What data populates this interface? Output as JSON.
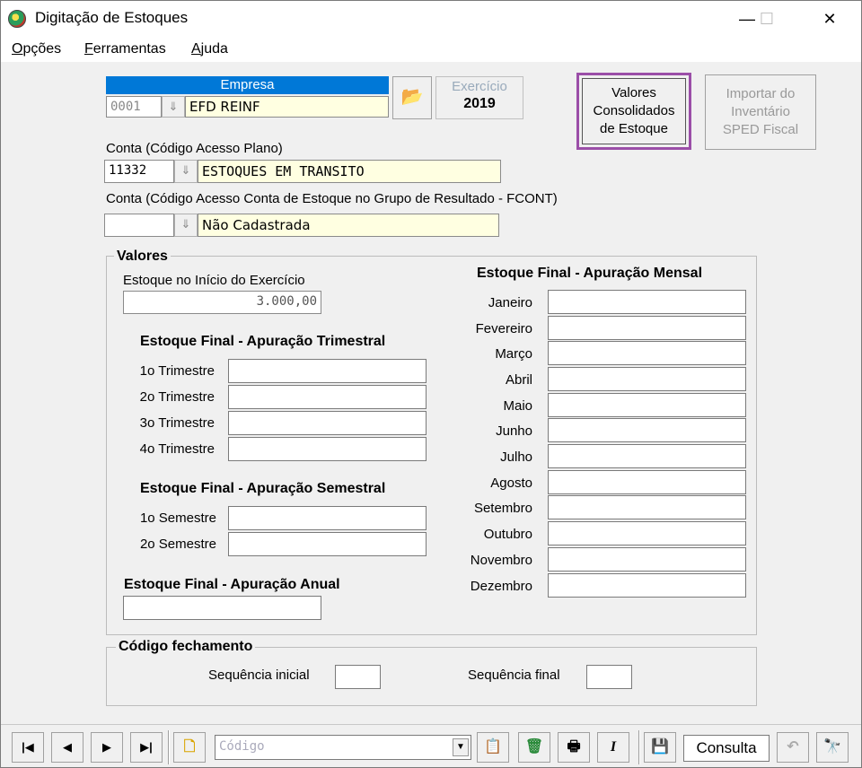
{
  "window": {
    "title": "Digitação de Estoques",
    "minimize": "—",
    "maximize": "☐",
    "close": "✕"
  },
  "menu": [
    {
      "prefix": "",
      "underline": "O",
      "rest": "pções"
    },
    {
      "prefix": "",
      "underline": "F",
      "rest": "erramentas"
    },
    {
      "prefix": "",
      "underline": "A",
      "rest": "juda"
    }
  ],
  "empresa": {
    "header": "Empresa",
    "code": "0001",
    "name": "EFD REINF",
    "exercicio_label": "Exercício",
    "exercicio_value": "2019"
  },
  "buttons": {
    "valores_consolidados": [
      "Valores",
      "Consolidados",
      "de Estoque"
    ],
    "importar": [
      "Importar do",
      "Inventário",
      "SPED Fiscal"
    ]
  },
  "conta": {
    "label": "Conta (Código Acesso Plano)",
    "code": "11332",
    "name": "ESTOQUES EM TRANSITO"
  },
  "conta_fcont": {
    "label": "Conta (Código Acesso Conta de Estoque no Grupo de Resultado - FCONT)",
    "code": "",
    "name": "Não Cadastrada"
  },
  "valores": {
    "title": "Valores",
    "estoque_inicio_label": "Estoque no Início do Exercício",
    "estoque_inicio_value": "3.000,00",
    "trimestral_title": "Estoque Final - Apuração Trimestral",
    "trimestres": [
      "1o Trimestre",
      "2o Trimestre",
      "3o Trimestre",
      "4o Trimestre"
    ],
    "semestral_title": "Estoque Final - Apuração Semestral",
    "semestres": [
      "1o Semestre",
      "2o Semestre"
    ],
    "anual_title": "Estoque Final - Apuração Anual",
    "mensal_title": "Estoque Final - Apuração Mensal",
    "meses": [
      "Janeiro",
      "Fevereiro",
      "Março",
      "Abril",
      "Maio",
      "Junho",
      "Julho",
      "Agosto",
      "Setembro",
      "Outubro",
      "Novembro",
      "Dezembro"
    ]
  },
  "fechamento": {
    "title": "Código fechamento",
    "seq_inicial_label": "Sequência inicial",
    "seq_final_label": "Sequência final"
  },
  "toolbar": {
    "first": "|◀",
    "prev": "◀",
    "next": "▶",
    "last": "▶|",
    "combo_placeholder": "Código",
    "mode": "Consulta",
    "italic": "I"
  }
}
